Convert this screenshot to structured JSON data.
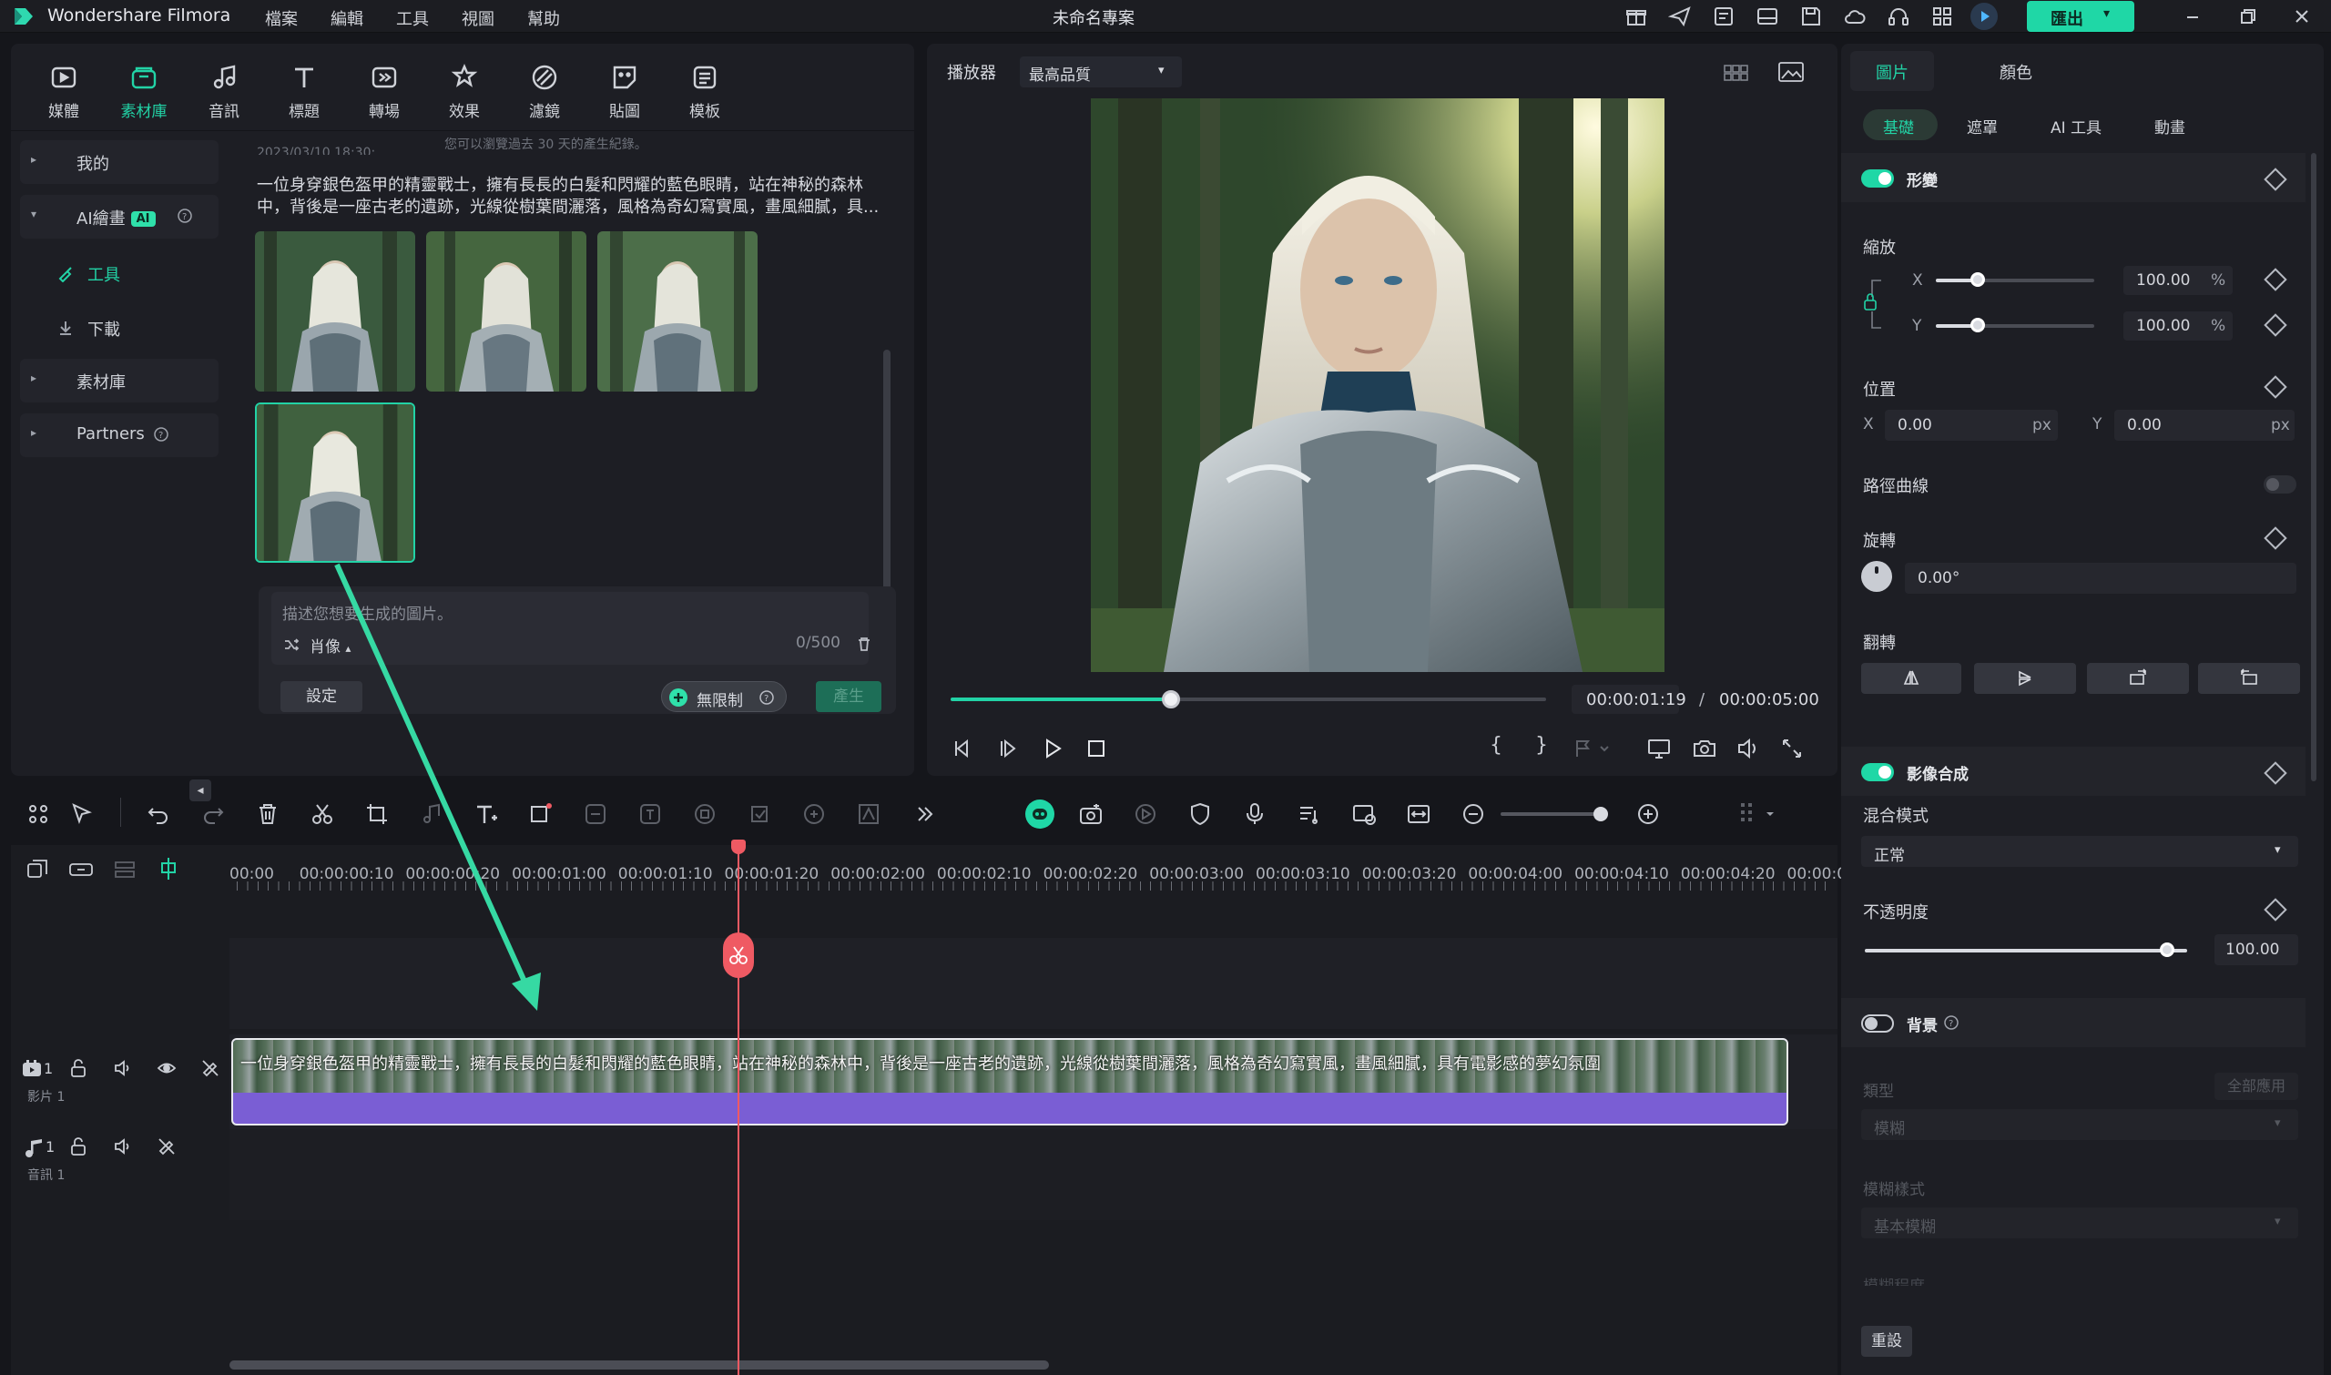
{
  "titlebar": {
    "app_name": "Wondershare Filmora",
    "menus": [
      "檔案",
      "編輯",
      "工具",
      "視圖",
      "幫助"
    ],
    "project_title": "未命名專案",
    "export_label": "匯出"
  },
  "media_tabs": [
    "媒體",
    "素材庫",
    "音訊",
    "標題",
    "轉場",
    "效果",
    "濾鏡",
    "貼圖",
    "模板"
  ],
  "sidebar": {
    "mine": "我的",
    "ai_images": "AI繪畫",
    "ai_badge": "AI",
    "tools": "工具",
    "downloads": "下載",
    "library": "素材庫",
    "partners": "Partners"
  },
  "content": {
    "history_notice": "您可以瀏覽過去 30 天的產生紀錄。",
    "date_partial": "2023/03/10 18:30:...",
    "description": "一位身穿銀色盔甲的精靈戰士，擁有長長的白髮和閃耀的藍色眼睛，站在神秘的森林中，背後是一座古老的遺跡，光線從樹葉間灑落，風格為奇幻寫實風，畫風細膩，具..."
  },
  "prompt": {
    "placeholder": "描述您想要生成的圖片。",
    "style_label": "肖像",
    "char_count": "0/500",
    "settings_label": "設定",
    "unlimited_label": "無限制",
    "generate_label": "產生"
  },
  "player": {
    "label": "播放器",
    "quality": "最高品質",
    "current_time": "00:00:01:19",
    "separator": "/",
    "total_time": "00:00:05:00",
    "progress": 0.37
  },
  "timeline": {
    "ruler": [
      "00:00",
      "00:00:00:10",
      "00:00:00:20",
      "00:00:01:00",
      "00:00:01:10",
      "00:00:01:20",
      "00:00:02:00",
      "00:00:02:10",
      "00:00:02:20",
      "00:00:03:00",
      "00:00:03:10",
      "00:00:03:20",
      "00:00:04:00",
      "00:00:04:10",
      "00:00:04:20",
      "00:00:05:00"
    ],
    "video_track": "影片 1",
    "video_track_num": "1",
    "audio_track": "音訊 1",
    "audio_track_num": "1",
    "clip_caption": "一位身穿銀色盔甲的精靈戰士，擁有長長的白髮和閃耀的藍色眼睛，站在神秘的森林中，背後是一座古老的遺跡，光線從樹葉間灑落，風格為奇幻寫實風，畫風細膩，具有電影感的夢幻氛圍"
  },
  "right_panel": {
    "tabs": [
      "圖片",
      "顏色"
    ],
    "subtabs": [
      "基礎",
      "遮罩",
      "AI 工具",
      "動畫"
    ],
    "transform": "形變",
    "scale": "縮放",
    "scale_x": "100.00",
    "scale_y": "100.00",
    "percent": "%",
    "position": "位置",
    "pos_x": "0.00",
    "pos_y": "0.00",
    "px": "px",
    "x_label": "X",
    "y_label": "Y",
    "path_curve": "路徑曲線",
    "rotation": "旋轉",
    "rotation_value": "0.00°",
    "flip": "翻轉",
    "compositing": "影像合成",
    "blend_mode_label": "混合模式",
    "blend_mode": "正常",
    "opacity_label": "不透明度",
    "opacity_value": "100.00",
    "background": "背景",
    "type_label": "類型",
    "apply_all": "全部應用",
    "blur_value": "模糊",
    "blur_style_label": "模糊樣式",
    "blur_style": "基本模糊",
    "blur_level_label": "模糊程度",
    "reset": "重設"
  },
  "colors": {
    "accent": "#22d3a6",
    "clip_purple": "#7a5ed4",
    "playhead": "#ef5a63"
  }
}
